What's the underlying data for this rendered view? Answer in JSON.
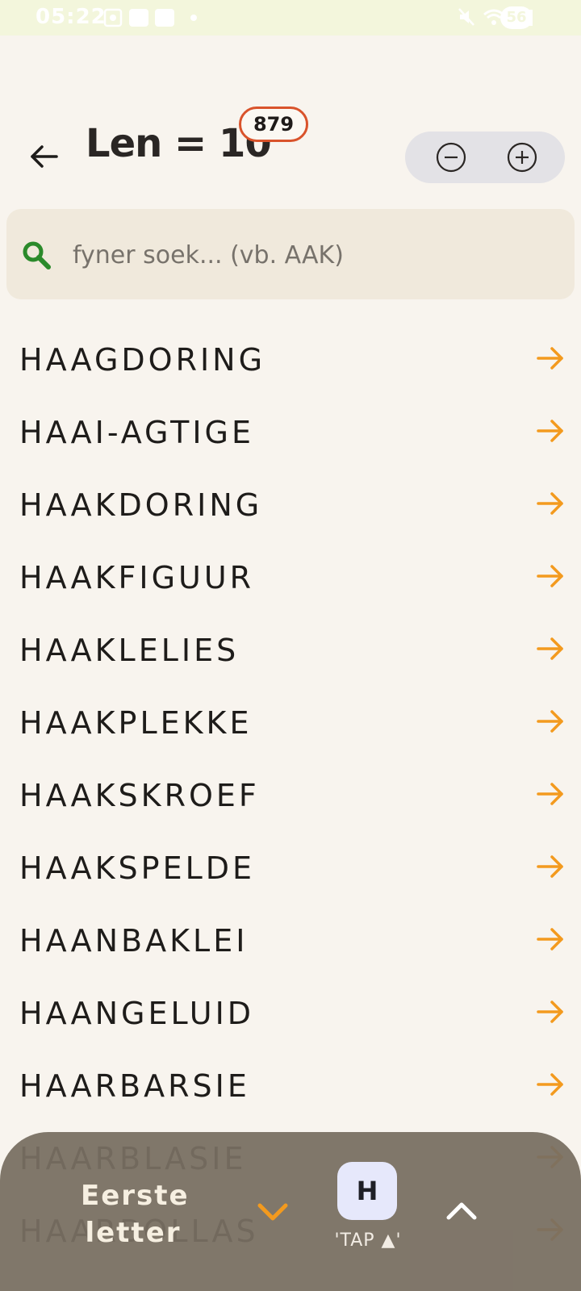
{
  "status_bar": {
    "time": "05:22",
    "battery": "56",
    "icons": [
      "screenshot-icon",
      "youtube-icon",
      "youtube-icon",
      "notification-dot",
      "mute-icon",
      "wifi-icon",
      "signal-icon",
      "battery-icon"
    ]
  },
  "header": {
    "title": "Len = 10",
    "count": "879"
  },
  "search": {
    "placeholder": "fyner soek... (vb. AAK)",
    "value": ""
  },
  "words": [
    "HAAGDORING",
    "HAAI-AGTIGE",
    "HAAKDORING",
    "HAAKFIGUUR",
    "HAAKLELIES",
    "HAAKPLEKKE",
    "HAAKSKROEF",
    "HAAKSPELDE",
    "HAANBAKLEI",
    "HAANGELUID",
    "HAARBARSIE",
    "HAARBLASIE",
    "HAARBOLLAS"
  ],
  "letter_bar": {
    "caption_line1": "Eerste",
    "caption_line2": "letter",
    "current_letter": "H",
    "hint": "'TAP ▲'"
  },
  "colors": {
    "accent": "#f39a1e",
    "badge_border": "#d9532b",
    "search_icon": "#2b8a2b",
    "background": "#f8f4ee"
  }
}
